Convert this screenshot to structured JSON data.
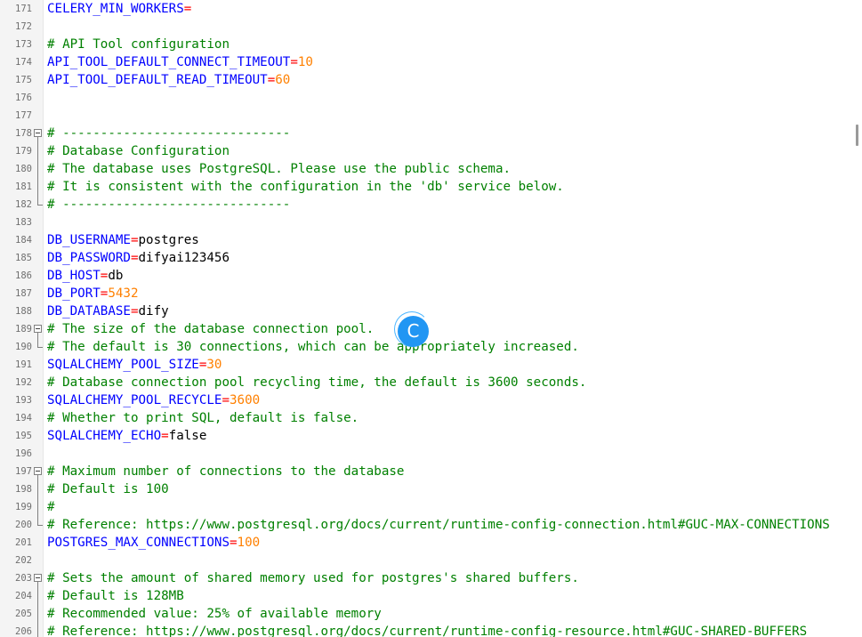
{
  "editor": {
    "lines": [
      {
        "n": "171",
        "t": "kv",
        "key": "CELERY_MIN_WORKERS",
        "val": "",
        "vt": "str"
      },
      {
        "n": "172",
        "t": "blank"
      },
      {
        "n": "173",
        "t": "cmt",
        "text": "# API Tool configuration"
      },
      {
        "n": "174",
        "t": "kv",
        "key": "API_TOOL_DEFAULT_CONNECT_TIMEOUT",
        "val": "10",
        "vt": "num"
      },
      {
        "n": "175",
        "t": "kv",
        "key": "API_TOOL_DEFAULT_READ_TIMEOUT",
        "val": "60",
        "vt": "num"
      },
      {
        "n": "176",
        "t": "blank"
      },
      {
        "n": "177",
        "t": "blank"
      },
      {
        "n": "178",
        "t": "cmt",
        "text": "# ------------------------------",
        "fold": "start"
      },
      {
        "n": "179",
        "t": "cmt",
        "text": "# Database Configuration",
        "fold": "mid"
      },
      {
        "n": "180",
        "t": "cmt",
        "text": "# The database uses PostgreSQL. Please use the public schema.",
        "fold": "mid"
      },
      {
        "n": "181",
        "t": "cmt",
        "text": "# It is consistent with the configuration in the 'db' service below.",
        "fold": "mid"
      },
      {
        "n": "182",
        "t": "cmt",
        "text": "# ------------------------------",
        "fold": "end"
      },
      {
        "n": "183",
        "t": "blank"
      },
      {
        "n": "184",
        "t": "kv",
        "key": "DB_USERNAME",
        "val": "postgres",
        "vt": "str"
      },
      {
        "n": "185",
        "t": "kv",
        "key": "DB_PASSWORD",
        "val": "difyai123456",
        "vt": "str"
      },
      {
        "n": "186",
        "t": "kv",
        "key": "DB_HOST",
        "val": "db",
        "vt": "str"
      },
      {
        "n": "187",
        "t": "kv",
        "key": "DB_PORT",
        "val": "5432",
        "vt": "num"
      },
      {
        "n": "188",
        "t": "kv",
        "key": "DB_DATABASE",
        "val": "dify",
        "vt": "str"
      },
      {
        "n": "189",
        "t": "cmt",
        "text": "# The size of the database connection pool.",
        "fold": "start"
      },
      {
        "n": "190",
        "t": "cmt",
        "text": "# The default is 30 connections, which can be appropriately increased.",
        "fold": "end"
      },
      {
        "n": "191",
        "t": "kv",
        "key": "SQLALCHEMY_POOL_SIZE",
        "val": "30",
        "vt": "num"
      },
      {
        "n": "192",
        "t": "cmt",
        "text": "# Database connection pool recycling time, the default is 3600 seconds."
      },
      {
        "n": "193",
        "t": "kv",
        "key": "SQLALCHEMY_POOL_RECYCLE",
        "val": "3600",
        "vt": "num"
      },
      {
        "n": "194",
        "t": "cmt",
        "text": "# Whether to print SQL, default is false."
      },
      {
        "n": "195",
        "t": "kv",
        "key": "SQLALCHEMY_ECHO",
        "val": "false",
        "vt": "str"
      },
      {
        "n": "196",
        "t": "blank"
      },
      {
        "n": "197",
        "t": "cmt",
        "text": "# Maximum number of connections to the database",
        "fold": "start"
      },
      {
        "n": "198",
        "t": "cmt",
        "text": "# Default is 100",
        "fold": "mid"
      },
      {
        "n": "199",
        "t": "cmt",
        "text": "#",
        "fold": "mid"
      },
      {
        "n": "200",
        "t": "cmt",
        "text": "# Reference: https://www.postgresql.org/docs/current/runtime-config-connection.html#GUC-MAX-CONNECTIONS",
        "fold": "end"
      },
      {
        "n": "201",
        "t": "kv",
        "key": "POSTGRES_MAX_CONNECTIONS",
        "val": "100",
        "vt": "num"
      },
      {
        "n": "202",
        "t": "blank"
      },
      {
        "n": "203",
        "t": "cmt",
        "text": "# Sets the amount of shared memory used for postgres's shared buffers.",
        "fold": "start"
      },
      {
        "n": "204",
        "t": "cmt",
        "text": "# Default is 128MB",
        "fold": "mid"
      },
      {
        "n": "205",
        "t": "cmt",
        "text": "# Recommended value: 25% of available memory",
        "fold": "mid"
      },
      {
        "n": "206",
        "t": "cmt",
        "text": "# Reference: https://www.postgresql.org/docs/current/runtime-config-resource.html#GUC-SHARED-BUFFERS",
        "fold": "mid"
      }
    ]
  },
  "overlay": {
    "badge_letter": "C",
    "badge_color": "#2196f3",
    "badge_icon": "loading-spinner-icon"
  },
  "colors": {
    "key": "#0000ff",
    "operator": "#ff0000",
    "number": "#ff8000",
    "comment": "#008000",
    "string": "#000000"
  }
}
